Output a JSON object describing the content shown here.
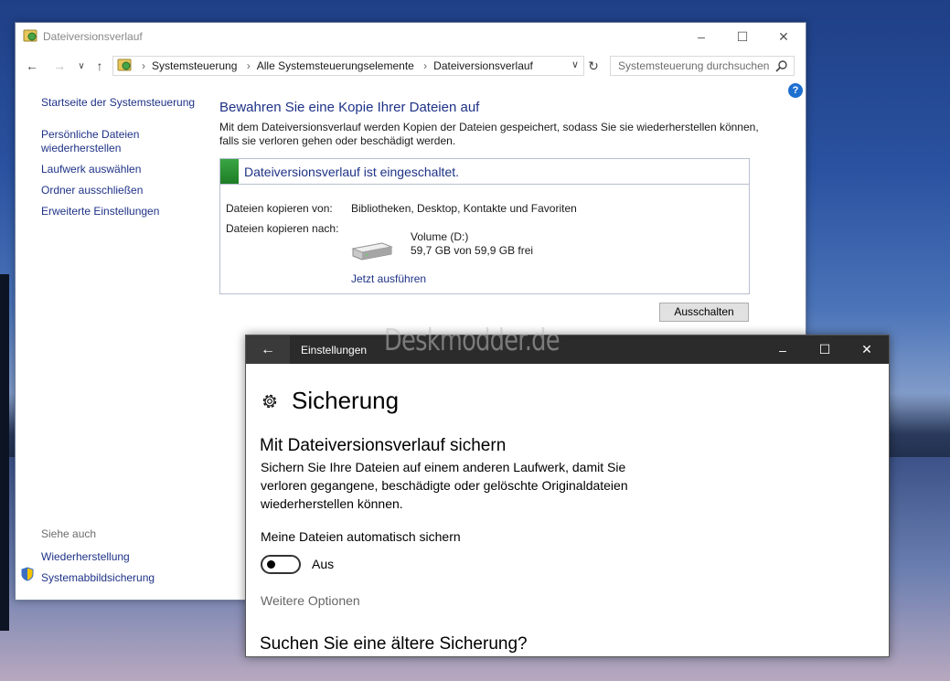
{
  "control_panel": {
    "title": "Dateiversionsverlauf",
    "breadcrumb": [
      "Systemsteuerung",
      "Alle Systemsteuerungselemente",
      "Dateiversionsverlauf"
    ],
    "search_placeholder": "Systemsteuerung durchsuchen",
    "sidebar": {
      "home": "Startseite der Systemsteuerung",
      "restore_line1": "Persönliche Dateien",
      "restore_line2": "wiederherstellen",
      "select_drive": "Laufwerk auswählen",
      "exclude_folders": "Ordner ausschließen",
      "advanced": "Erweiterte Einstellungen",
      "see_also": "Siehe auch",
      "recovery": "Wiederherstellung",
      "system_image": "Systemabbildsicherung"
    },
    "main": {
      "heading": "Bewahren Sie eine Kopie Ihrer Dateien auf",
      "desc_line1": "Mit dem Dateiversionsverlauf werden Kopien der Dateien gespeichert, sodass Sie sie wiederherstellen können,",
      "desc_line2": "falls sie verloren gehen oder beschädigt werden.",
      "status": "Dateiversionsverlauf ist eingeschaltet.",
      "copy_from_label": "Dateien kopieren von:",
      "copy_from_value": "Bibliotheken, Desktop, Kontakte und Favoriten",
      "copy_to_label": "Dateien kopieren nach:",
      "volume_name": "Volume (D:)",
      "volume_free": "59,7 GB von 59,9 GB frei",
      "run_now": "Jetzt ausführen",
      "turn_off": "Ausschalten"
    },
    "status_color": "#2e9a38",
    "link_color": "#1e3287"
  },
  "watermark": "Deskmodder.de",
  "settings": {
    "title": "Einstellungen",
    "page_title": "Sicherung",
    "section_title": "Mit Dateiversionsverlauf sichern",
    "desc_line1": "Sichern Sie Ihre Dateien auf einem anderen Laufwerk, damit Sie",
    "desc_line2": "verloren gegangene, beschädigte oder gelöschte Originaldateien",
    "desc_line3": "wiederherstellen können.",
    "auto_backup_label": "Meine Dateien automatisch sichern",
    "toggle_state": "Aus",
    "more_options": "Weitere Optionen",
    "older_backup": "Suchen Sie eine ältere Sicherung?"
  }
}
